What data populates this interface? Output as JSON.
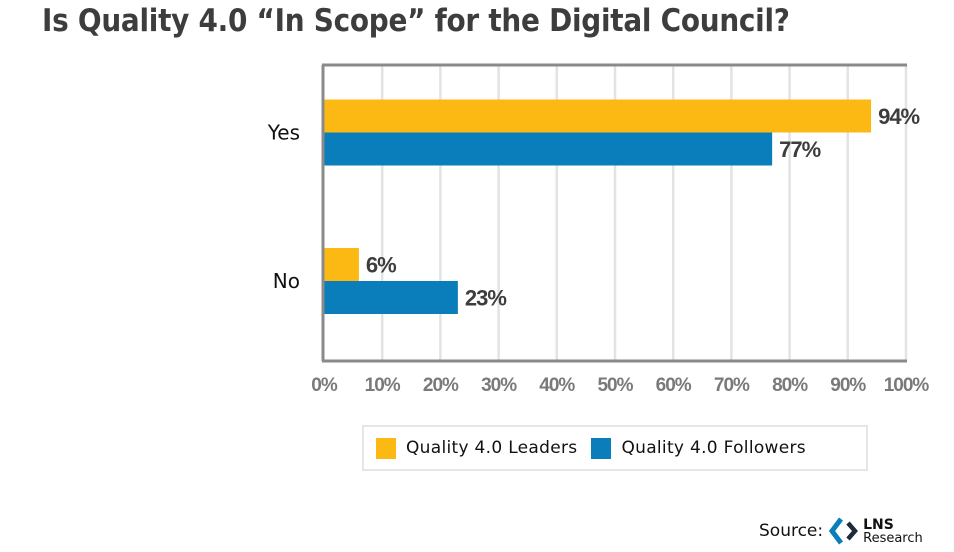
{
  "chart_data": {
    "type": "bar",
    "orientation": "horizontal",
    "title": "Is Quality 4.0 “In Scope” for the Digital Council?",
    "categories": [
      "Yes",
      "No"
    ],
    "series": [
      {
        "name": "Quality 4.0 Leaders",
        "color": "#fdb913",
        "values": [
          94,
          6
        ],
        "labels": [
          "94%",
          "6%"
        ]
      },
      {
        "name": "Quality 4.0 Followers",
        "color": "#0a7dbb",
        "values": [
          77,
          23
        ],
        "labels": [
          "77%",
          "23%"
        ]
      }
    ],
    "xlabel": "",
    "ylabel": "",
    "xlim": [
      0,
      100
    ],
    "xticks": [
      0,
      10,
      20,
      30,
      40,
      50,
      60,
      70,
      80,
      90,
      100
    ],
    "xtick_labels": [
      "0%",
      "10%",
      "20%",
      "30%",
      "40%",
      "50%",
      "60%",
      "70%",
      "80%",
      "90%",
      "100%"
    ],
    "grid": true,
    "legend_position": "bottom"
  },
  "source": {
    "label": "Source:",
    "brand": "LNS",
    "brand_sub": "Research"
  },
  "colors": {
    "axis": "#8a8a8a",
    "grid": "#e3e3e3",
    "logo_blue": "#0a7dbb",
    "logo_dark": "#1d2a3a"
  }
}
